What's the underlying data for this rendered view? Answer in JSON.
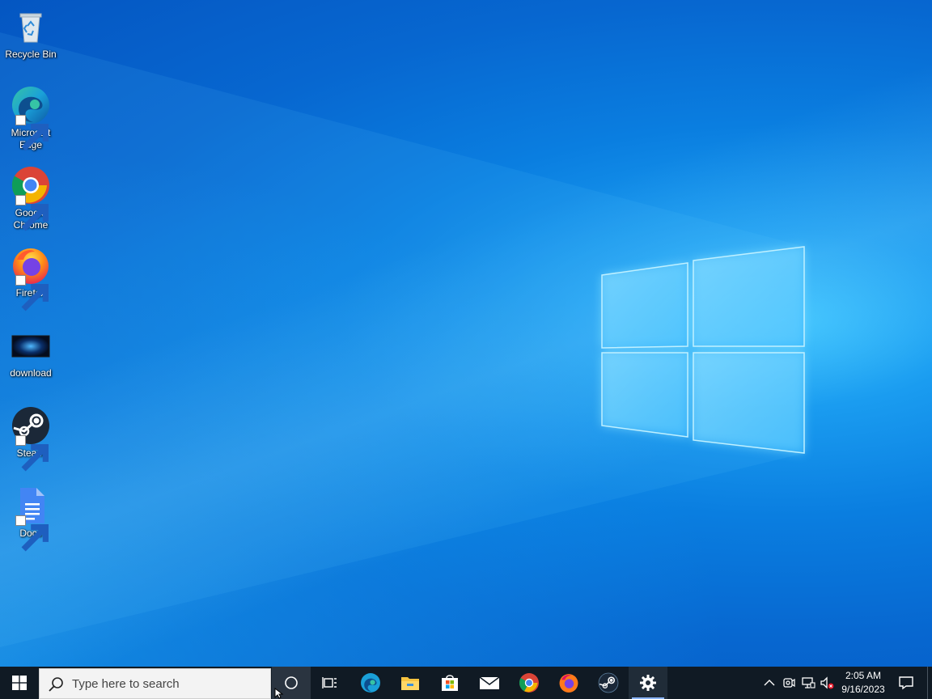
{
  "desktop": {
    "icons": [
      {
        "label": "Recycle Bin",
        "icon": "recycle-bin-icon"
      },
      {
        "label": "Microsoft Edge",
        "icon": "edge-icon"
      },
      {
        "label": "Google Chrome",
        "icon": "chrome-icon"
      },
      {
        "label": "Firefox",
        "icon": "firefox-icon"
      },
      {
        "label": "download",
        "icon": "image-file-icon"
      },
      {
        "label": "Steam",
        "icon": "steam-icon"
      },
      {
        "label": "Docs",
        "icon": "google-docs-icon"
      }
    ]
  },
  "taskbar": {
    "start_icon": "windows-logo-icon",
    "search": {
      "placeholder": "Type here to search",
      "icon": "search-icon"
    },
    "cortana_icon": "cortana-circle-icon",
    "task_view_icon": "task-view-icon",
    "pinned": [
      {
        "name": "Microsoft Edge",
        "icon": "edge-icon"
      },
      {
        "name": "File Explorer",
        "icon": "folder-icon"
      },
      {
        "name": "Microsoft Store",
        "icon": "store-bag-icon"
      },
      {
        "name": "Mail",
        "icon": "mail-icon"
      },
      {
        "name": "Google Chrome",
        "icon": "chrome-icon"
      },
      {
        "name": "Firefox",
        "icon": "firefox-icon"
      },
      {
        "name": "Steam",
        "icon": "steam-icon"
      },
      {
        "name": "Settings",
        "icon": "gear-icon",
        "active": true
      }
    ],
    "tray": {
      "icons": [
        "chevron-up-icon",
        "webcam-icon",
        "network-icon",
        "volume-muted-icon"
      ],
      "time": "2:05 AM",
      "date": "9/16/2023"
    },
    "notification_icon": "notification-icon"
  },
  "colors": {
    "taskbar_bg": "#101a24",
    "desktop_blue": "#0a7ee0",
    "active_indicator": "#8ab4f8"
  }
}
